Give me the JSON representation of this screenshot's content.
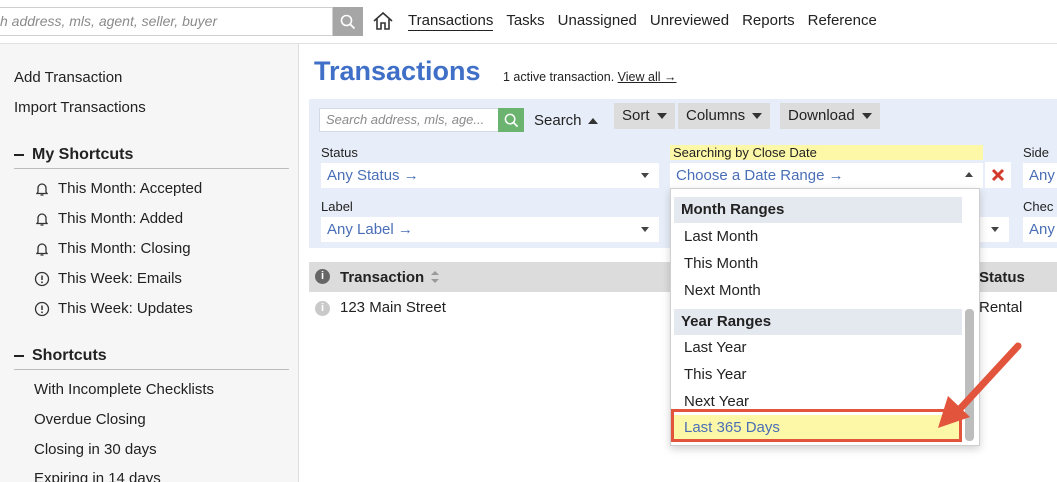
{
  "topbar": {
    "search_placeholder": "h address, mls, agent, seller, buyer",
    "nav": [
      "Transactions",
      "Tasks",
      "Unassigned",
      "Unreviewed",
      "Reports",
      "Reference"
    ]
  },
  "sidebar": {
    "add_transaction": "Add Transaction",
    "import_transactions": "Import Transactions",
    "my_shortcuts_title": "My Shortcuts",
    "my_shortcuts": [
      {
        "label": "This Month: Accepted",
        "icon": "bell-icon"
      },
      {
        "label": "This Month: Added",
        "icon": "bell-icon"
      },
      {
        "label": "This Month: Closing",
        "icon": "bell-icon"
      },
      {
        "label": "This Week: Emails",
        "icon": "alert-circle-icon"
      },
      {
        "label": "This Week: Updates",
        "icon": "alert-circle-icon"
      }
    ],
    "shortcuts_title": "Shortcuts",
    "shortcuts": [
      "With Incomplete Checklists",
      "Overdue Closing",
      "Closing in 30 days",
      "Expiring in 14 days"
    ]
  },
  "main": {
    "title": "Transactions",
    "active_note": "1 active transaction.",
    "view_all": "View all →",
    "toolbar": {
      "search_placeholder": "Search address, mls, age...",
      "search_label": "Search",
      "sort": "Sort",
      "columns": "Columns",
      "download": "Download"
    },
    "filters": {
      "status_label": "Status",
      "status_value": "Any Status →",
      "date_label": "Searching by Close Date",
      "date_value": "Choose a Date Range →",
      "side_label": "Side",
      "side_value": "Any",
      "label_label": "Label",
      "label_value": "Any Label →",
      "check_label": "Chec",
      "check_value": "Any"
    },
    "table": {
      "col_transaction": "Transaction",
      "col_status": "Status",
      "rows": [
        {
          "address": "123 Main Street",
          "status": "Rental"
        }
      ]
    }
  },
  "dropdown": {
    "month_group": "Month Ranges",
    "month_options": [
      "Last Month",
      "This Month",
      "Next Month"
    ],
    "year_group": "Year Ranges",
    "year_options": [
      "Last Year",
      "This Year",
      "Next Year"
    ],
    "selected_option": "Last 365 Days"
  },
  "colors": {
    "brand_blue": "#3f6fc6",
    "highlight_yellow": "#fdf7a8",
    "annotation_red": "#e2543b",
    "search_green": "#6ab46f"
  }
}
